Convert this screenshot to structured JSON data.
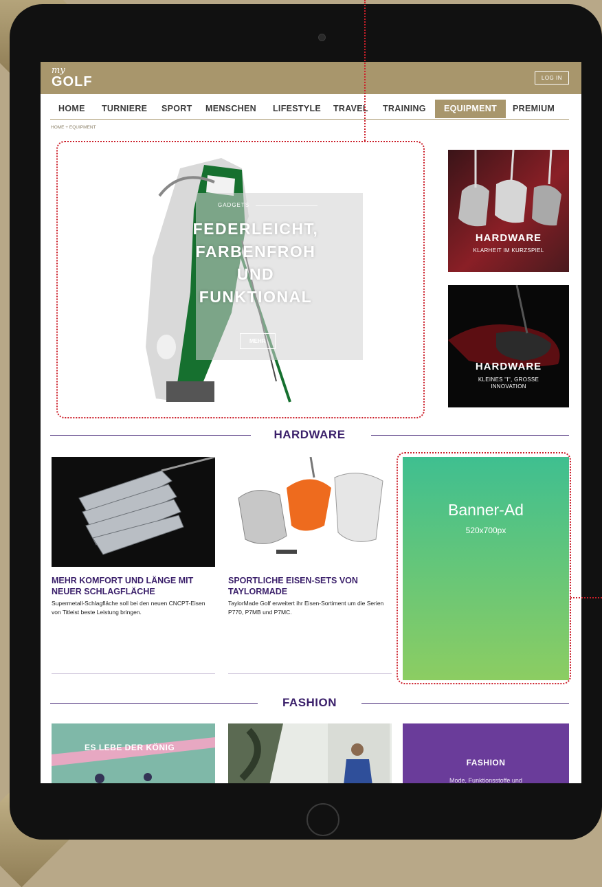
{
  "site": {
    "logo_my": "my",
    "logo_golf": "GOLF",
    "login_label": "LOG IN"
  },
  "nav": {
    "items": [
      "HOME",
      "TURNIERE",
      "SPORT",
      "MENSCHEN",
      "LIFESTYLE",
      "TRAVEL",
      "TRAINING",
      "EQUIPMENT",
      "PREMIUM"
    ],
    "active": "EQUIPMENT"
  },
  "breadcrumb": "HOME + EQUIPMENT",
  "hero": {
    "category": "GADGETS",
    "title_lines": [
      "FEDERLEICHT,",
      "FARBENFROH",
      "UND",
      "FUNKTIONAL"
    ],
    "button": "MEHR"
  },
  "side_cards": [
    {
      "title": "HARDWARE",
      "subtitle": "KLARHEIT IM KURZSPIEL"
    },
    {
      "title": "HARDWARE",
      "subtitle_lines": [
        "KLEINES \"I\", GROSSE",
        "INNOVATION"
      ]
    }
  ],
  "sections": {
    "hardware": "HARDWARE",
    "fashion": "FASHION"
  },
  "articles": [
    {
      "title": "MEHR KOMFORT UND LÄNGE MIT NEUER SCHLAGFLÄCHE",
      "excerpt": "Supermetall-Schlagfläche soll bei den neuen CNCPT-Eisen von Titleist beste Leistung bringen."
    },
    {
      "title": "SPORTLICHE EISEN-SETS VON TAYLORMADE",
      "excerpt": "TaylorMade Golf erweitert ihr Eisen-Sortiment um die Serien P770, P7MB und P7MC."
    }
  ],
  "banner_ad": {
    "title": "Banner-Ad",
    "size": "520x700px"
  },
  "fashion_cards": [
    {
      "overlay": "ES LEBE DER KÖNIG"
    },
    {
      "overlay": ""
    },
    {
      "title": "FASHION",
      "subtitle": "Mode, Funktionsstoffe und"
    }
  ],
  "colors": {
    "gold": "#a8966c",
    "purple": "#3a1f6a",
    "annotation_red": "#cc1f2a",
    "banner_top": "#3fbf90",
    "banner_bottom": "#8ccd62",
    "bag_green": "#16702f"
  }
}
